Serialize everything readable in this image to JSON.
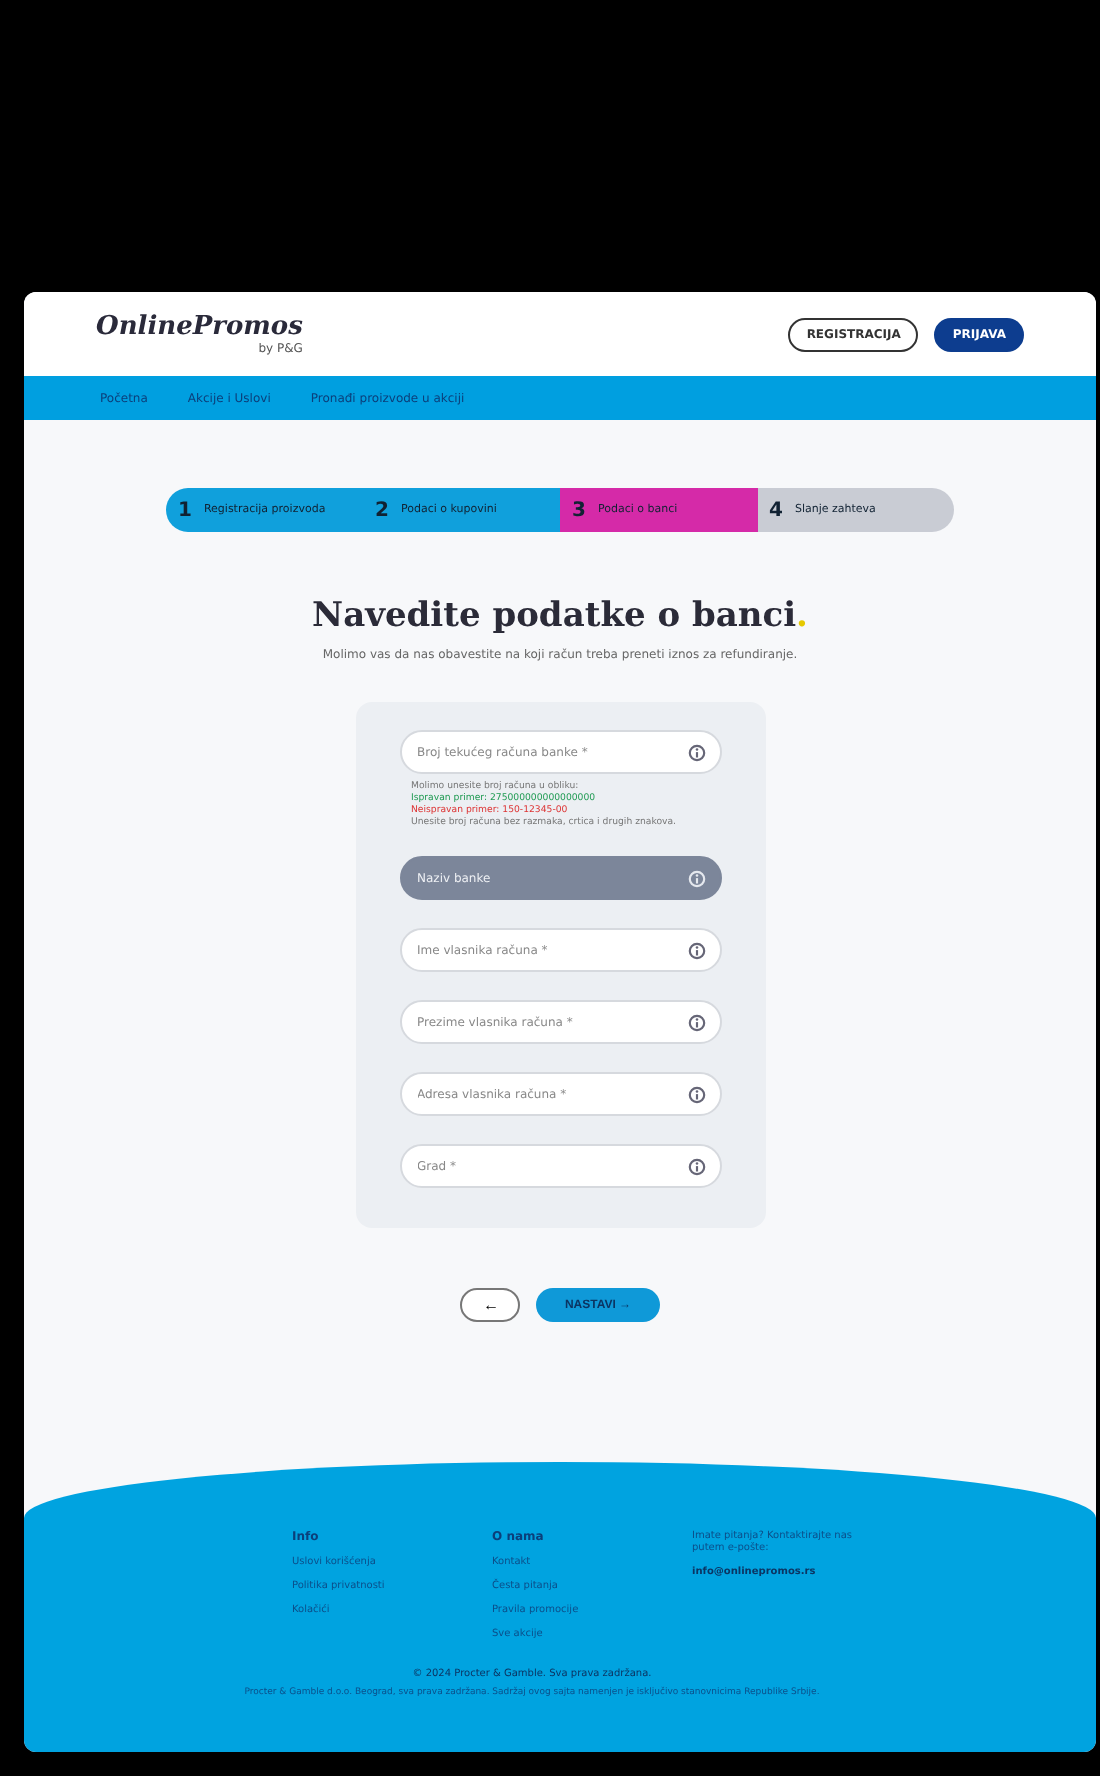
{
  "header": {
    "logo": "OnlinePromos",
    "logo_sub": "by P&G",
    "buttons": [
      {
        "label": "REGISTRACIJA",
        "kind": "outline"
      },
      {
        "label": "PRIJAVA",
        "kind": "solid"
      }
    ]
  },
  "nav": [
    {
      "label": "Početna"
    },
    {
      "label": "Akcije i Uslovi"
    },
    {
      "label": "Pronađi proizvode u akciji"
    }
  ],
  "steps": [
    {
      "number": "1",
      "label": "Registracija proizvoda",
      "kind": "done"
    },
    {
      "number": "2",
      "label": "Podaci o kupovini",
      "kind": "done"
    },
    {
      "number": "3",
      "label": "Podaci o banci",
      "kind": "current"
    },
    {
      "number": "4",
      "label": "Slanje zahteva",
      "kind": "upcoming"
    }
  ],
  "title": "Navedite podatke o banci",
  "title_mark": ".",
  "subtitle": "Molimo vas da nas obavestite na koji račun treba preneti iznos za refundiranje.",
  "form": {
    "fields": [
      {
        "placeholder": "Broj tekućeg računa banke *",
        "disabled": false,
        "hints": [
          {
            "text": "Molimo unesite broj računa u obliku:",
            "kind": "plain"
          },
          {
            "text": "Ispravan primer: 275000000000000000",
            "kind": "valid"
          },
          {
            "text": "Neispravan primer: 150-12345-00",
            "kind": "invalid"
          },
          {
            "text": "Unesite broj računa bez razmaka, crtica i drugih znakova.",
            "kind": "plain"
          }
        ]
      },
      {
        "placeholder": "Naziv banke",
        "disabled": true
      },
      {
        "placeholder": "Ime vlasnika računa *",
        "disabled": false
      },
      {
        "placeholder": "Prezime vlasnika računa *",
        "disabled": false
      },
      {
        "placeholder": "Adresa vlasnika računa *",
        "disabled": false
      },
      {
        "placeholder": "Grad *",
        "disabled": false
      }
    ]
  },
  "actions": {
    "back": "←",
    "next": "NASTAVI",
    "next_arrow": "→"
  },
  "footer": {
    "columns": [
      {
        "heading": "Info",
        "links": [
          "Uslovi korišćenja",
          "Politika privatnosti",
          "Kolačići"
        ]
      },
      {
        "heading": "O nama",
        "links": [
          "Kontakt",
          "Česta pitanja",
          "Pravila promocije",
          "Sve akcije"
        ]
      }
    ],
    "contact_text": "Imate pitanja? Kontaktirajte nas putem e-pošte:",
    "contact_link": "info@onlinepromos.rs",
    "copyright": "© 2024 Procter & Gamble. Sva prava zadržana.",
    "legal": "Procter & Gamble d.o.o. Beograd, sva prava zadržana. Sadržaj ovog sajta namenjen je isključivo stanovnicima Republike Srbije."
  }
}
